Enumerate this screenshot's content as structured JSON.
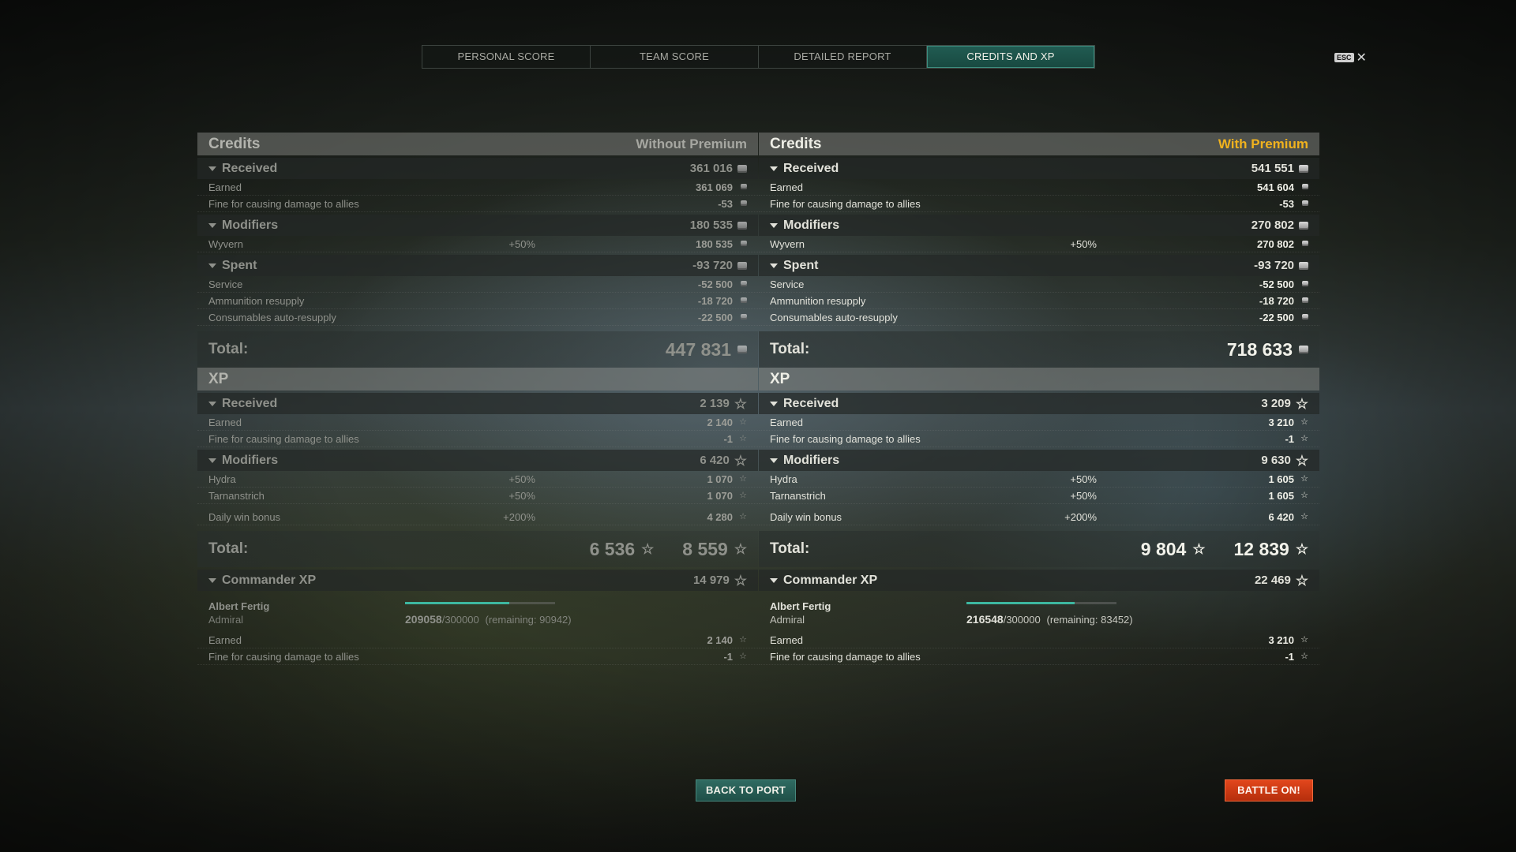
{
  "tabs": [
    "PERSONAL SCORE",
    "TEAM SCORE",
    "DETAILED REPORT",
    "CREDITS AND XP"
  ],
  "active_tab": 3,
  "esc": {
    "key": "ESC",
    "close": "✕"
  },
  "colors": {
    "accent": "#1e5a50",
    "premium": "#f0b21e",
    "battle": "#d33a12",
    "xp_bonus": "#c6e07a"
  },
  "left": {
    "credits_title": "Credits",
    "premium_label": "Without Premium",
    "received": {
      "label": "Received",
      "value": "361 016",
      "rows": [
        {
          "label": "Earned",
          "value": "361 069"
        },
        {
          "label": "Fine for causing damage to allies",
          "value": "-53"
        }
      ]
    },
    "modifiers": {
      "label": "Modifiers",
      "value": "180 535",
      "rows": [
        {
          "label": "Wyvern",
          "pct": "+50%",
          "value": "180 535"
        }
      ]
    },
    "spent": {
      "label": "Spent",
      "value": "-93 720",
      "rows": [
        {
          "label": "Service",
          "value": "-52 500"
        },
        {
          "label": "Ammunition resupply",
          "value": "-18 720"
        },
        {
          "label": "Consumables auto-resupply",
          "value": "-22 500"
        }
      ]
    },
    "credits_total_label": "Total:",
    "credits_total": "447 831",
    "xp_title": "XP",
    "xp_received": {
      "label": "Received",
      "value": "2 139",
      "rows": [
        {
          "label": "Earned",
          "value": "2 140"
        },
        {
          "label": "Fine for causing damage to allies",
          "value": "-1"
        }
      ]
    },
    "xp_modifiers": {
      "label": "Modifiers",
      "value": "6 420",
      "rows": [
        {
          "label": "Hydra",
          "pct": "+50%",
          "value": "1 070"
        },
        {
          "label": "Tarnanstrich",
          "pct": "+50%",
          "value": "1 070"
        },
        {
          "label": "Daily win bonus",
          "pct": "+200%",
          "value": "4 280"
        }
      ]
    },
    "xp_total_label": "Total:",
    "xp_total_base": "6 536",
    "xp_total": "8 559",
    "commander": {
      "label": "Commander XP",
      "value": "14 979",
      "name": "Albert Fertig",
      "rank": "Admiral",
      "current": "209058",
      "max": "/300000",
      "remaining": "(remaining: 90942)",
      "progress": 0.697,
      "rows": [
        {
          "label": "Earned",
          "value": "2 140"
        },
        {
          "label": "Fine for causing damage to allies",
          "value": "-1"
        }
      ]
    }
  },
  "right": {
    "credits_title": "Credits",
    "premium_label": "With Premium",
    "received": {
      "label": "Received",
      "value": "541 551",
      "rows": [
        {
          "label": "Earned",
          "value": "541 604"
        },
        {
          "label": "Fine for causing damage to allies",
          "value": "-53"
        }
      ]
    },
    "modifiers": {
      "label": "Modifiers",
      "value": "270 802",
      "rows": [
        {
          "label": "Wyvern",
          "pct": "+50%",
          "value": "270 802"
        }
      ]
    },
    "spent": {
      "label": "Spent",
      "value": "-93 720",
      "rows": [
        {
          "label": "Service",
          "value": "-52 500"
        },
        {
          "label": "Ammunition resupply",
          "value": "-18 720"
        },
        {
          "label": "Consumables auto-resupply",
          "value": "-22 500"
        }
      ]
    },
    "credits_total_label": "Total:",
    "credits_total": "718 633",
    "xp_title": "XP",
    "xp_received": {
      "label": "Received",
      "value": "3 209",
      "rows": [
        {
          "label": "Earned",
          "value": "3 210"
        },
        {
          "label": "Fine for causing damage to allies",
          "value": "-1"
        }
      ]
    },
    "xp_modifiers": {
      "label": "Modifiers",
      "value": "9 630",
      "rows": [
        {
          "label": "Hydra",
          "pct": "+50%",
          "value": "1 605"
        },
        {
          "label": "Tarnanstrich",
          "pct": "+50%",
          "value": "1 605"
        },
        {
          "label": "Daily win bonus",
          "pct": "+200%",
          "value": "6 420"
        }
      ]
    },
    "xp_total_label": "Total:",
    "xp_total_base": "9 804",
    "xp_total": "12 839",
    "commander": {
      "label": "Commander XP",
      "value": "22 469",
      "name": "Albert Fertig",
      "rank": "Admiral",
      "current": "216548",
      "max": "/300000",
      "remaining": "(remaining: 83452)",
      "progress": 0.722,
      "rows": [
        {
          "label": "Earned",
          "value": "3 210"
        },
        {
          "label": "Fine for causing damage to allies",
          "value": "-1"
        }
      ]
    }
  },
  "buttons": {
    "back": "BACK TO PORT",
    "battle": "BATTLE ON!"
  }
}
